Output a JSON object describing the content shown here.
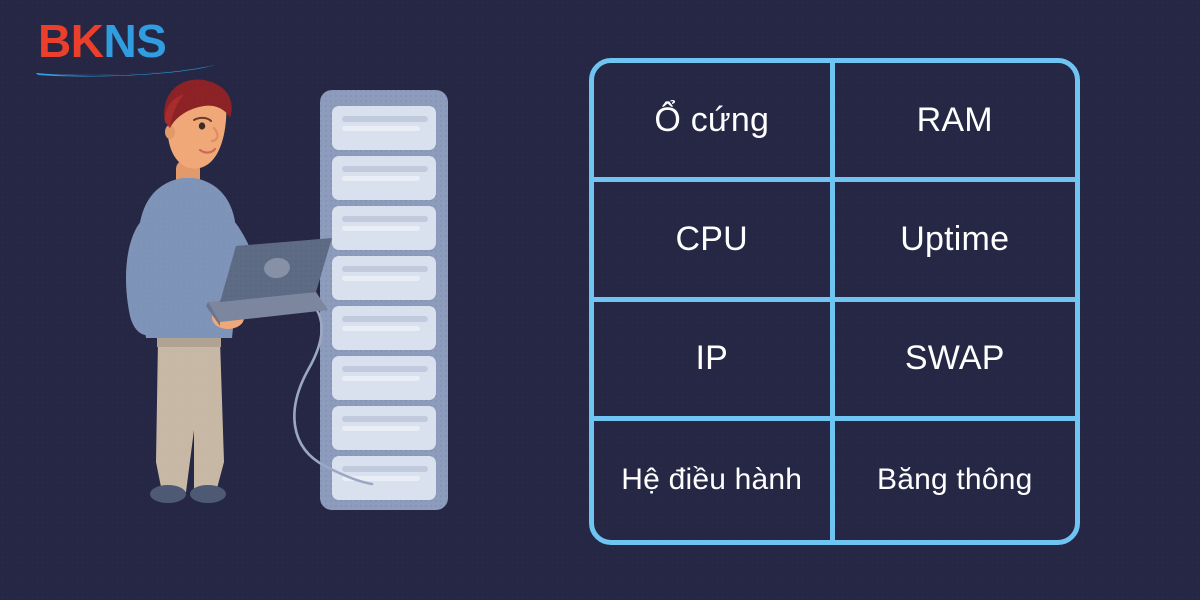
{
  "brand": {
    "name_part1": "BK",
    "name_part2": "NS",
    "color_part1": "#EC3F2B",
    "color_part2": "#2F9DE0",
    "swoosh_color": "#2F9DE0"
  },
  "theme": {
    "background": "#252745",
    "table_border": "#6FC4F2",
    "text": "#FFFFFF"
  },
  "illustration": {
    "person": {
      "hair_color": "#8C2226",
      "skin_color": "#F0A878",
      "shirt_color": "#7E93B8",
      "pants_color": "#C7B8A6",
      "shoe_color": "#4E5A73"
    },
    "laptop": {
      "body_color": "#6D7893",
      "lid_color": "#5E6B84"
    },
    "server_rack": {
      "frame_color": "#8D9CBC",
      "unit_color": "#DCE3F0",
      "unit_count": 8
    },
    "cable_color": "#9BA8C4"
  },
  "spec_table": {
    "rows": [
      [
        {
          "label": "Ổ cứng"
        },
        {
          "label": "RAM"
        }
      ],
      [
        {
          "label": "CPU"
        },
        {
          "label": "Uptime"
        }
      ],
      [
        {
          "label": "IP"
        },
        {
          "label": "SWAP"
        }
      ],
      [
        {
          "label": "Hệ điều hành"
        },
        {
          "label": "Băng thông"
        }
      ]
    ]
  }
}
